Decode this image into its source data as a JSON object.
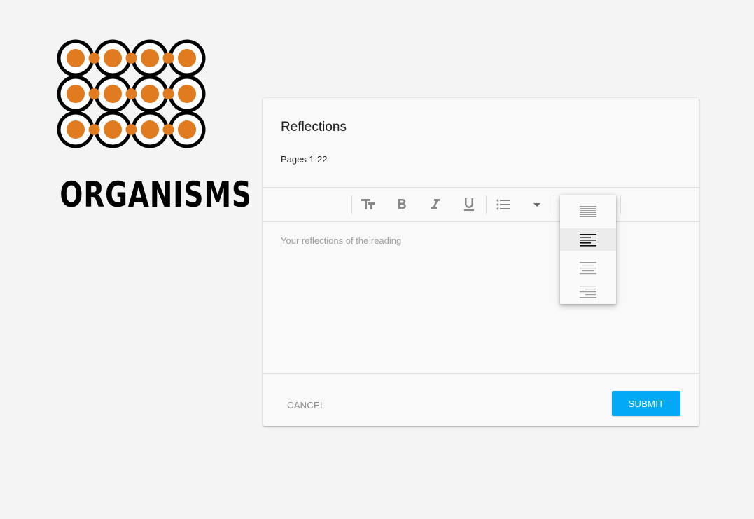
{
  "brand": {
    "name": "ORGANISMS",
    "colors": {
      "ring": "#000000",
      "dot": "#e07b20"
    }
  },
  "form": {
    "title": "Reflections",
    "subtitle": "Pages 1-22",
    "editor_placeholder": "Your reflections of the reading",
    "cancel_label": "CANCEL",
    "submit_label": "SUBMIT",
    "accent_color": "#03a9f4"
  },
  "toolbar": {
    "buttons": [
      "text-size-icon",
      "bold-icon",
      "italic-icon",
      "underline-icon",
      "bulleted-list-icon",
      "dropdown-arrow-icon"
    ]
  },
  "align_menu": {
    "options": [
      "align-justify-icon",
      "align-left-icon",
      "align-center-icon",
      "align-right-icon"
    ],
    "selected": "align-left-icon"
  }
}
